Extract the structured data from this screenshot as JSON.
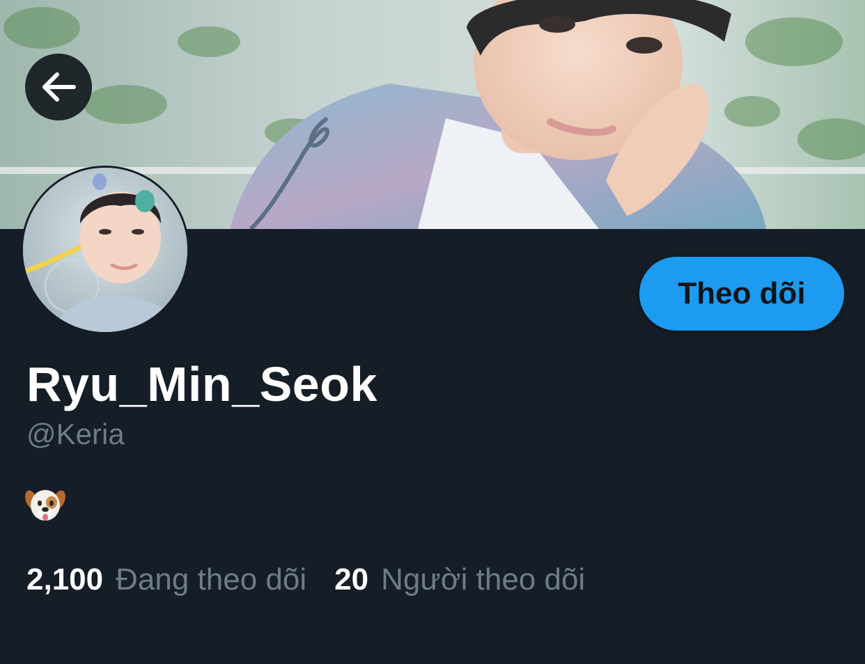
{
  "profile": {
    "display_name": "Ryu_Min_Seok",
    "handle": "@Keria",
    "bio_emoji": "dog-face-emoji"
  },
  "actions": {
    "follow_label": "Theo dõi",
    "back_icon": "arrow-left-icon"
  },
  "stats": {
    "following_count": "2,100",
    "following_label": "Đang theo dõi",
    "followers_count": "20",
    "followers_label": "Người theo dõi"
  },
  "colors": {
    "background": "#151d27",
    "accent": "#1d9bf0",
    "secondary_text": "#6e7c89",
    "primary_text": "#ffffff"
  }
}
